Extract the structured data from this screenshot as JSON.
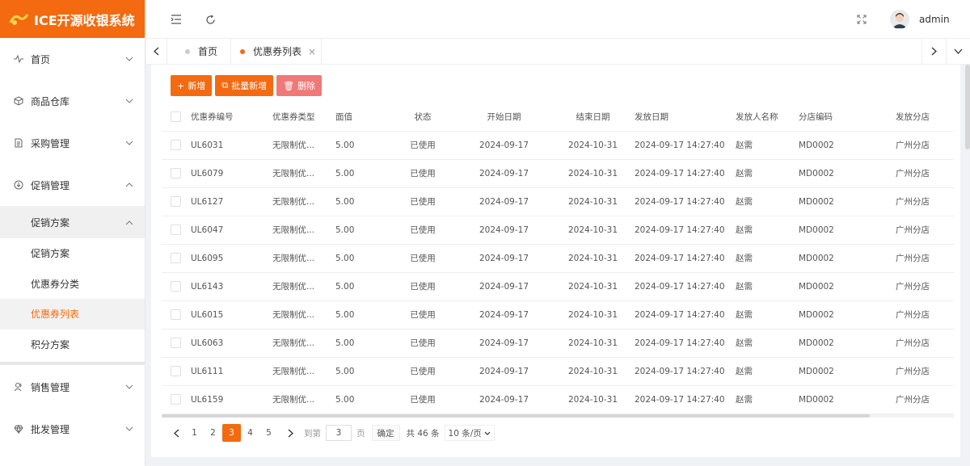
{
  "app": {
    "title": "ICE开源收银系统",
    "brand_color": "#f36a10"
  },
  "sidebar": {
    "menus": [
      {
        "label": "首页",
        "icon": "activity-icon"
      },
      {
        "label": "商品仓库",
        "icon": "box-icon"
      },
      {
        "label": "采购管理",
        "icon": "document-icon"
      },
      {
        "label": "促销管理",
        "icon": "download-circle-icon"
      }
    ],
    "submenu_head": "促销方案",
    "sub_items": [
      "促销方案",
      "优惠券分类",
      "优惠券列表",
      "积分方案"
    ],
    "active_sub": "优惠券列表",
    "menus_bottom": [
      {
        "label": "销售管理",
        "icon": "users-icon"
      },
      {
        "label": "批发管理",
        "icon": "diamond-icon"
      }
    ]
  },
  "header": {
    "username": "admin"
  },
  "tabs": [
    {
      "label": "首页"
    },
    {
      "label": "优惠券列表",
      "close": "×"
    }
  ],
  "toolbar": {
    "add": "新增",
    "batch_add": "批量新增",
    "delete": "删除"
  },
  "table": {
    "columns": [
      "优惠券编号",
      "优惠券类型",
      "面值",
      "状态",
      "开始日期",
      "结束日期",
      "发放日期",
      "发放人名称",
      "分店编码",
      "发放分店"
    ],
    "rows": [
      [
        "UL6031",
        "无限制优...",
        "5.00",
        "已使用",
        "2024-09-17",
        "2024-10-31",
        "2024-09-17 14:27:40",
        "赵需",
        "MD0002",
        "广州分店"
      ],
      [
        "UL6079",
        "无限制优...",
        "5.00",
        "已使用",
        "2024-09-17",
        "2024-10-31",
        "2024-09-17 14:27:40",
        "赵需",
        "MD0002",
        "广州分店"
      ],
      [
        "UL6127",
        "无限制优...",
        "5.00",
        "已使用",
        "2024-09-17",
        "2024-10-31",
        "2024-09-17 14:27:40",
        "赵需",
        "MD0002",
        "广州分店"
      ],
      [
        "UL6047",
        "无限制优...",
        "5.00",
        "已使用",
        "2024-09-17",
        "2024-10-31",
        "2024-09-17 14:27:40",
        "赵需",
        "MD0002",
        "广州分店"
      ],
      [
        "UL6095",
        "无限制优...",
        "5.00",
        "已使用",
        "2024-09-17",
        "2024-10-31",
        "2024-09-17 14:27:40",
        "赵需",
        "MD0002",
        "广州分店"
      ],
      [
        "UL6143",
        "无限制优...",
        "5.00",
        "已使用",
        "2024-09-17",
        "2024-10-31",
        "2024-09-17 14:27:40",
        "赵需",
        "MD0002",
        "广州分店"
      ],
      [
        "UL6015",
        "无限制优...",
        "5.00",
        "已使用",
        "2024-09-17",
        "2024-10-31",
        "2024-09-17 14:27:40",
        "赵需",
        "MD0002",
        "广州分店"
      ],
      [
        "UL6063",
        "无限制优...",
        "5.00",
        "已使用",
        "2024-09-17",
        "2024-10-31",
        "2024-09-17 14:27:40",
        "赵需",
        "MD0002",
        "广州分店"
      ],
      [
        "UL6111",
        "无限制优...",
        "5.00",
        "已使用",
        "2024-09-17",
        "2024-10-31",
        "2024-09-17 14:27:40",
        "赵需",
        "MD0002",
        "广州分店"
      ],
      [
        "UL6159",
        "无限制优...",
        "5.00",
        "已使用",
        "2024-09-17",
        "2024-10-31",
        "2024-09-17 14:27:40",
        "赵需",
        "MD0002",
        "广州分店"
      ]
    ]
  },
  "pagination": {
    "pages": [
      "1",
      "2",
      "3",
      "4",
      "5"
    ],
    "current": "3",
    "goto_label": "到第",
    "goto_value": "3",
    "page_unit": "页",
    "confirm": "确定",
    "total": "共 46 条",
    "page_size": "10 条/页"
  }
}
